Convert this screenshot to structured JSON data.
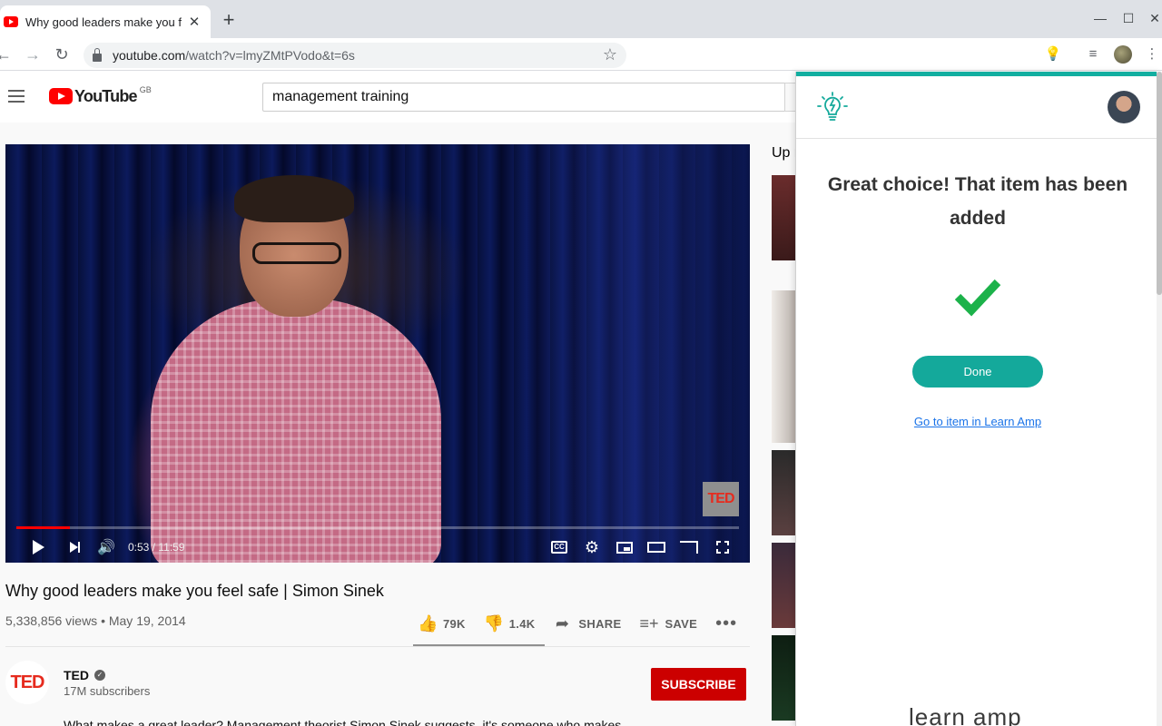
{
  "browser": {
    "tab_title": "Why good leaders make you f",
    "url_host": "youtube.com",
    "url_path": "/watch?v=lmyZMtPVodo&t=6s",
    "icons": [
      "back-arrow-icon",
      "forward-arrow-icon",
      "reload-icon",
      "lock-icon",
      "star-icon",
      "learn-amp-extension-icon",
      "media-queue-icon",
      "profile-avatar",
      "kebab-menu-icon",
      "minimize-icon",
      "maximize-icon",
      "close-icon"
    ]
  },
  "youtube": {
    "logo_text": "YouTube",
    "region": "GB",
    "search_value": "management training",
    "player": {
      "progress_fraction": 0.074,
      "time": "0:53 / 11:59",
      "watermark": "TED"
    },
    "video": {
      "title": "Why good leaders make you feel safe | Simon Sinek",
      "meta": "5,338,856 views • May 19, 2014",
      "likes": "79K",
      "dislikes": "1.4K",
      "share": "SHARE",
      "save": "SAVE"
    },
    "channel": {
      "avatar_text": "TED",
      "name": "TED",
      "subscribers": "17M subscribers",
      "subscribe_label": "SUBSCRIBE"
    },
    "description": "What makes a great leader? Management theorist Simon Sinek suggests, it's someone who makes",
    "up_next_label": "Up next"
  },
  "learn_amp": {
    "heading": "Great choice! That item has been added",
    "done_label": "Done",
    "link_label": "Go to item in Learn Amp",
    "footer_logo": "learn amp",
    "accent_color": "#14a99b"
  }
}
